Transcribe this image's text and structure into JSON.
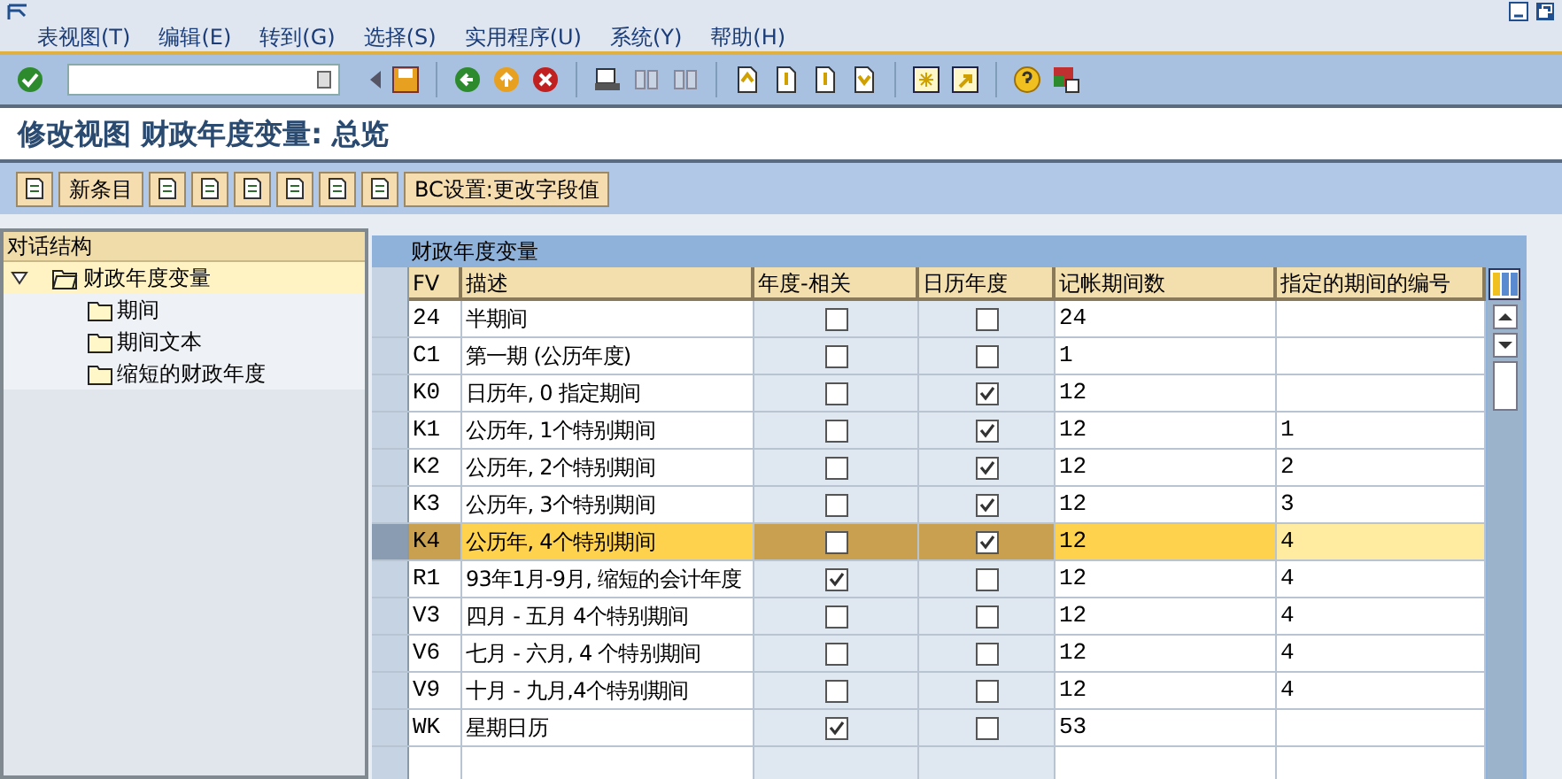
{
  "menu": [
    "表视图(T)",
    "编辑(E)",
    "转到(G)",
    "选择(S)",
    "实用程序(U)",
    "系统(Y)",
    "帮助(H)"
  ],
  "title": "修改视图 财政年度变量: 总览",
  "app_toolbar": [
    {
      "kind": "icon"
    },
    {
      "kind": "text",
      "label": "新条目"
    },
    {
      "kind": "icon"
    },
    {
      "kind": "icon"
    },
    {
      "kind": "icon"
    },
    {
      "kind": "icon"
    },
    {
      "kind": "icon"
    },
    {
      "kind": "icon"
    },
    {
      "kind": "text",
      "label": "BC设置:更改字段值"
    }
  ],
  "tree": {
    "title": "对话结构",
    "root": {
      "label": "财政年度变量",
      "expanded": true,
      "selected": true,
      "children": [
        {
          "label": "期间",
          "selected": false
        },
        {
          "label": "期间文本",
          "selected": false
        },
        {
          "label": "缩短的财政年度",
          "selected": false
        }
      ]
    }
  },
  "table": {
    "title": "财政年度变量",
    "columns": [
      "FV",
      "描述",
      "年度-相关",
      "日历年度",
      "记帐期间数",
      "指定的期间的编号"
    ],
    "rows": [
      {
        "fv": "24",
        "desc": "半期间",
        "year_dependent": false,
        "calendar_year": false,
        "periods": "24",
        "special": "",
        "selected": false
      },
      {
        "fv": "C1",
        "desc": "第一期 (公历年度)",
        "year_dependent": false,
        "calendar_year": false,
        "periods": "1",
        "special": "",
        "selected": false
      },
      {
        "fv": "K0",
        "desc": "日历年, 0 指定期间",
        "year_dependent": false,
        "calendar_year": true,
        "periods": "12",
        "special": "",
        "selected": false
      },
      {
        "fv": "K1",
        "desc": "公历年, 1个特别期间",
        "year_dependent": false,
        "calendar_year": true,
        "periods": "12",
        "special": "1",
        "selected": false
      },
      {
        "fv": "K2",
        "desc": "公历年, 2个特别期间",
        "year_dependent": false,
        "calendar_year": true,
        "periods": "12",
        "special": "2",
        "selected": false
      },
      {
        "fv": "K3",
        "desc": "公历年, 3个特别期间",
        "year_dependent": false,
        "calendar_year": true,
        "periods": "12",
        "special": "3",
        "selected": false
      },
      {
        "fv": "K4",
        "desc": "公历年, 4个特别期间",
        "year_dependent": false,
        "calendar_year": true,
        "periods": "12",
        "special": "4",
        "selected": true
      },
      {
        "fv": "R1",
        "desc": "93年1月-9月, 缩短的会计年度",
        "year_dependent": true,
        "calendar_year": false,
        "periods": "12",
        "special": "4",
        "selected": false
      },
      {
        "fv": "V3",
        "desc": "四月 - 五月 4个特别期间",
        "year_dependent": false,
        "calendar_year": false,
        "periods": "12",
        "special": "4",
        "selected": false
      },
      {
        "fv": "V6",
        "desc": "七月 - 六月, 4 个特别期间",
        "year_dependent": false,
        "calendar_year": false,
        "periods": "12",
        "special": "4",
        "selected": false
      },
      {
        "fv": "V9",
        "desc": "十月 - 九月,4个特别期间",
        "year_dependent": false,
        "calendar_year": false,
        "periods": "12",
        "special": "4",
        "selected": false
      },
      {
        "fv": "WK",
        "desc": "星期日历",
        "year_dependent": true,
        "calendar_year": false,
        "periods": "53",
        "special": "",
        "selected": false
      }
    ]
  }
}
